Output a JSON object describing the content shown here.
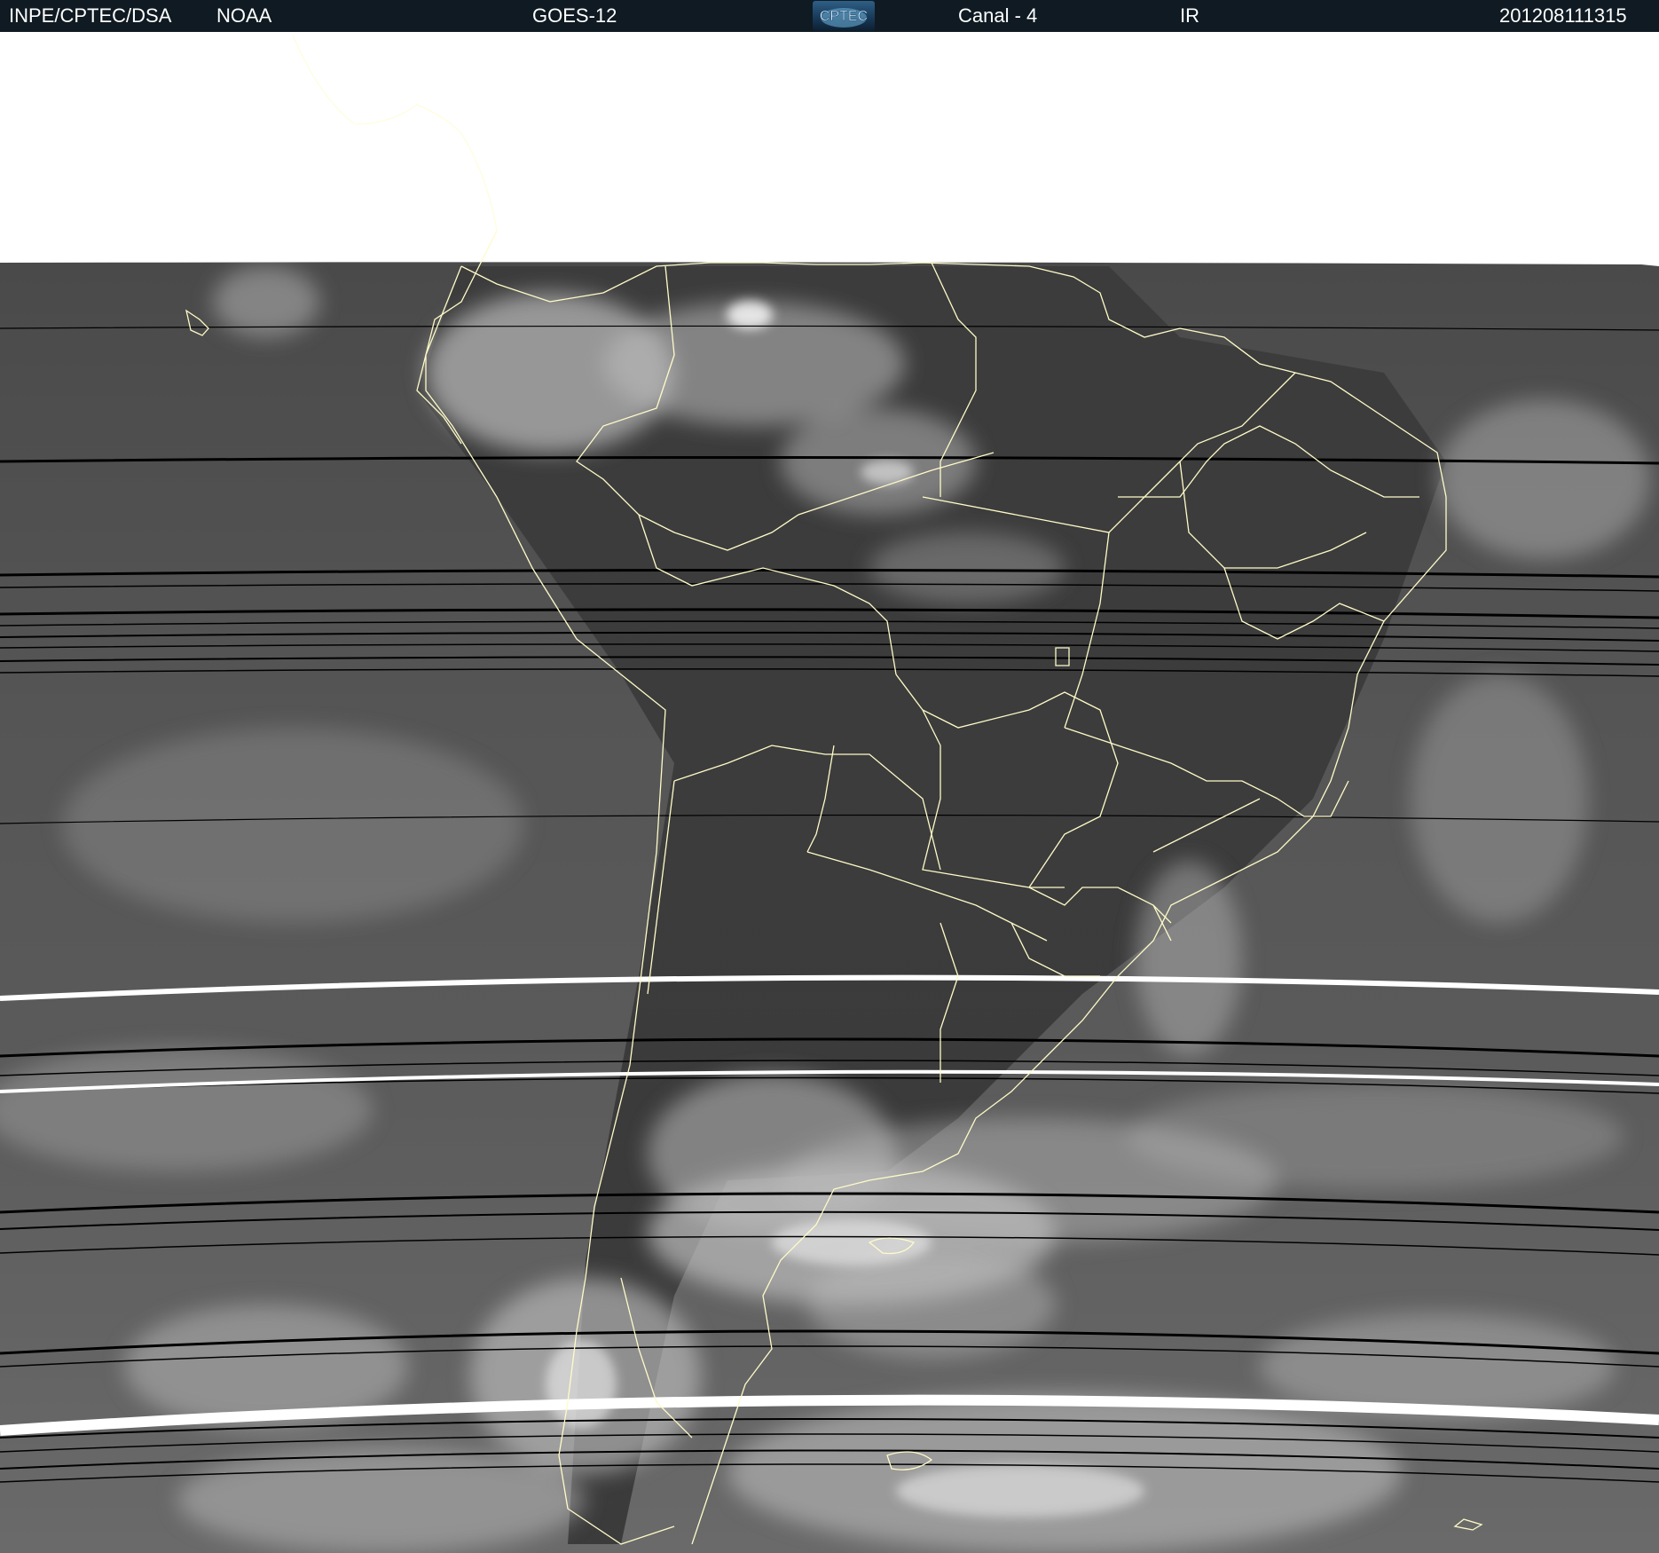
{
  "header": {
    "agency": "INPE/CPTEC/DSA",
    "source": "NOAA",
    "satellite": "GOES-12",
    "logo_text": "CPTEC",
    "channel": "Canal - 4",
    "band": "IR",
    "timestamp": "201208111315"
  },
  "colors": {
    "header_bg": "#0f1a22",
    "header_text": "#ffffff",
    "border_lines": "#fffbc8",
    "no_data": "#ffffff",
    "scan_line_dark": "#000000",
    "scan_line_bright": "#ffffff"
  }
}
